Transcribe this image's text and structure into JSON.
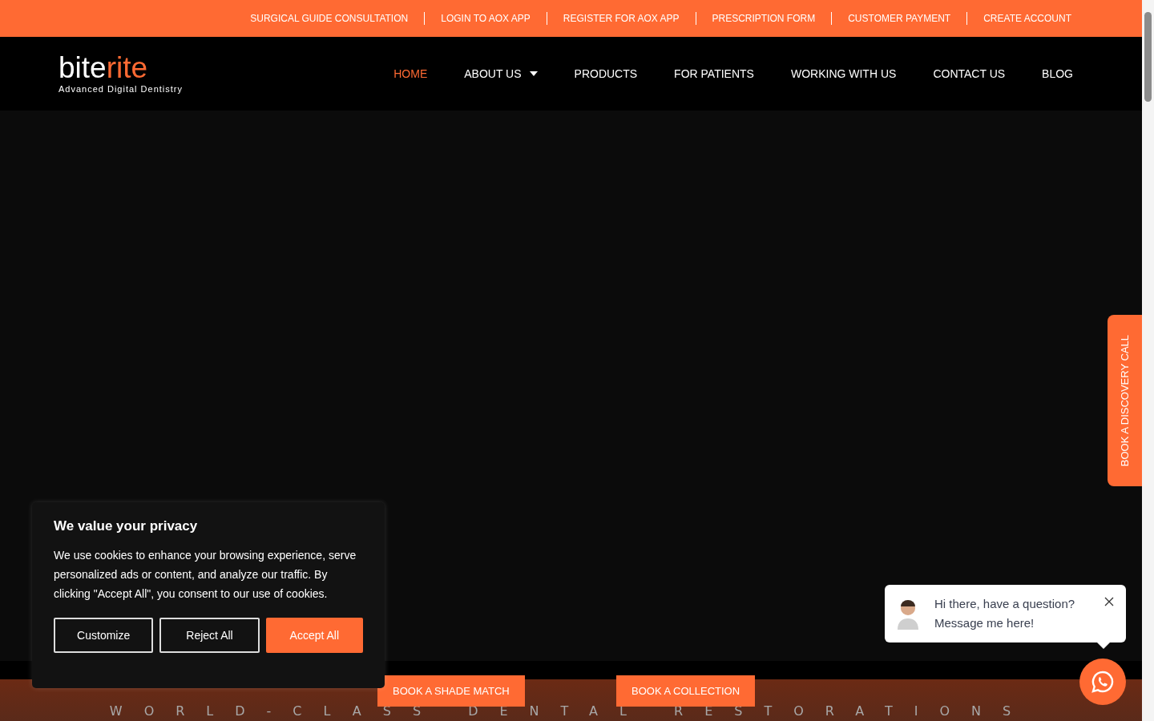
{
  "top_bar": {
    "links": [
      "SURGICAL GUIDE CONSULTATION",
      "LOGIN TO AOX APP",
      "REGISTER FOR AOX APP",
      "PRESCRIPTION FORM",
      "CUSTOMER PAYMENT",
      "CREATE ACCOUNT"
    ]
  },
  "logo": {
    "part_1": "bite",
    "part_2": "rite",
    "tagline": "Advanced Digital Dentistry"
  },
  "nav": [
    {
      "label": "HOME",
      "selected": true,
      "has_dropdown": false
    },
    {
      "label": "ABOUT US",
      "selected": false,
      "has_dropdown": true
    },
    {
      "label": "PRODUCTS",
      "selected": false,
      "has_dropdown": false
    },
    {
      "label": "FOR PATIENTS",
      "selected": false,
      "has_dropdown": false
    },
    {
      "label": "WORKING WITH US",
      "selected": false,
      "has_dropdown": false
    },
    {
      "label": "CONTACT US",
      "selected": false,
      "has_dropdown": false
    },
    {
      "label": "BLOG",
      "selected": false,
      "has_dropdown": false
    }
  ],
  "side_tab": "BOOK A DISCOVERY CALL",
  "cookie_banner": {
    "title": "We value your privacy",
    "text": "We use cookies to enhance your browsing experience, serve personalized ads or content, and analyze our traffic. By clicking \"Accept All\", you consent to our use of cookies.",
    "buttons": [
      {
        "label": "Customize",
        "kind": "outline"
      },
      {
        "label": "Reject All",
        "kind": "outline"
      },
      {
        "label": "Accept All",
        "kind": "primary"
      }
    ]
  },
  "cta_buttons": [
    "BOOK A SHADE MATCH",
    "BOOK A COLLECTION"
  ],
  "tagline": "WORLD-CLASS DENTAL RESTORATIONS",
  "chat_popup": {
    "line_1": "Hi there, have a question?",
    "line_2": "Message me here!"
  }
}
